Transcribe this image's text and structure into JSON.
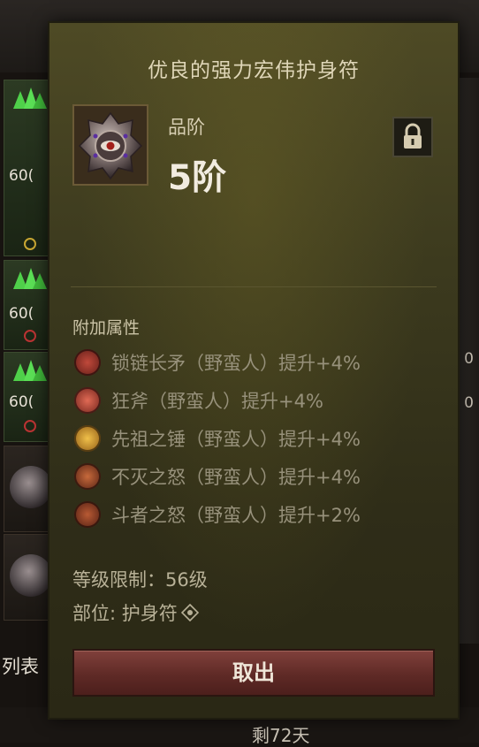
{
  "background": {
    "left_numbers": [
      "60(",
      "60(",
      "60("
    ],
    "right_numbers": [
      "0",
      "0"
    ],
    "bottom_left_text": "列表",
    "footer_text": "剩72天"
  },
  "item": {
    "title": "优良的强力宏伟护身符",
    "grade_label": "品阶",
    "grade_value": "5阶",
    "lock_icon": "lock-icon"
  },
  "attributes": {
    "heading": "附加属性",
    "rows": [
      {
        "icon": "chain-spear-skill-icon",
        "text": "锁链长矛（野蛮人）提升+4%",
        "color": "#7a2a24"
      },
      {
        "icon": "frenzy-axe-skill-icon",
        "text": "狂斧（野蛮人）提升+4%",
        "color": "#8a3328"
      },
      {
        "icon": "ancestor-hammer-skill-icon",
        "text": "先祖之锤（野蛮人）提升+4%",
        "color": "#b57a1e"
      },
      {
        "icon": "undying-rage-skill-icon",
        "text": "不灭之怒（野蛮人）提升+4%",
        "color": "#8d3a1e"
      },
      {
        "icon": "fighter-rage-skill-icon",
        "text": "斗者之怒（野蛮人）提升+2%",
        "color": "#7d3320"
      }
    ]
  },
  "info": {
    "level_req": "等级限制：56级",
    "slot": "部位: 护身符",
    "slot_icon": "amulet-slot-icon"
  },
  "actions": {
    "take_out_label": "取出"
  }
}
